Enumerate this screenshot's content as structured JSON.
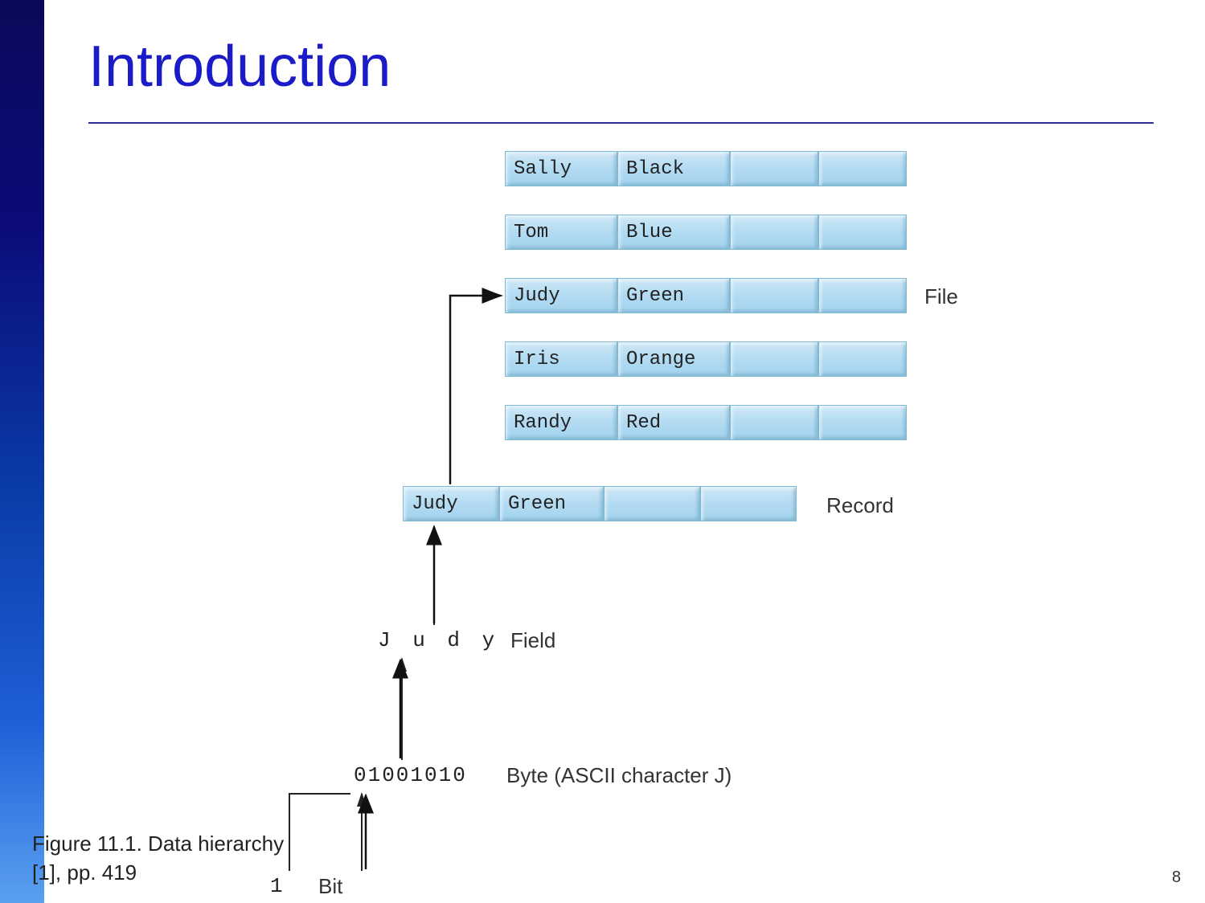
{
  "title": "Introduction",
  "file_rows": [
    [
      "Sally",
      "Black",
      "",
      ""
    ],
    [
      "Tom",
      "Blue",
      "",
      ""
    ],
    [
      "Judy",
      "Green",
      "",
      ""
    ],
    [
      "Iris",
      "Orange",
      "",
      ""
    ],
    [
      "Randy",
      "Red",
      "",
      ""
    ]
  ],
  "record_row": [
    "Judy",
    "Green",
    "",
    ""
  ],
  "field_text": "J u d y",
  "byte_text": "01001010",
  "bit_text": "1",
  "labels": {
    "file": "File",
    "record": "Record",
    "field": "Field",
    "byte": "Byte (ASCII character J)",
    "bit": "Bit"
  },
  "caption_line1": "Figure 11.1. Data hierarchy",
  "caption_line2": "[1], pp. 419",
  "page_number": "8"
}
